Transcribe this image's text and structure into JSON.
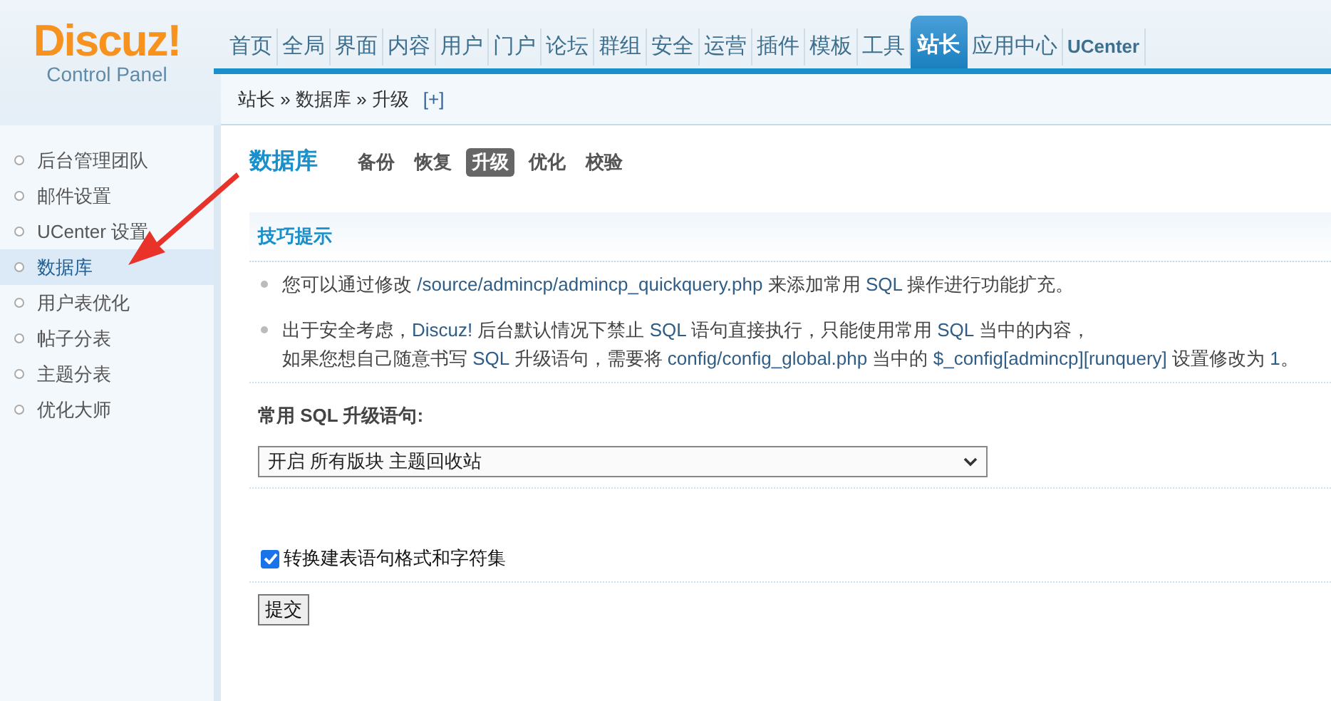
{
  "logo": {
    "name": "Discuz!",
    "subtitle": "Control Panel"
  },
  "nav": [
    {
      "label": "首页",
      "selected": false
    },
    {
      "label": "全局",
      "selected": false
    },
    {
      "label": "界面",
      "selected": false
    },
    {
      "label": "内容",
      "selected": false
    },
    {
      "label": "用户",
      "selected": false
    },
    {
      "label": "门户",
      "selected": false
    },
    {
      "label": "论坛",
      "selected": false
    },
    {
      "label": "群组",
      "selected": false
    },
    {
      "label": "安全",
      "selected": false
    },
    {
      "label": "运营",
      "selected": false
    },
    {
      "label": "插件",
      "selected": false
    },
    {
      "label": "模板",
      "selected": false
    },
    {
      "label": "工具",
      "selected": false
    },
    {
      "label": "站长",
      "selected": true
    },
    {
      "label": "应用中心",
      "selected": false
    },
    {
      "label": "UCenter",
      "selected": false
    }
  ],
  "breadcrumb": {
    "items": [
      "站长",
      "数据库",
      "升级"
    ],
    "separator": "»",
    "add": "[+]"
  },
  "sidebar": {
    "items": [
      {
        "label": "后台管理团队",
        "selected": false
      },
      {
        "label": "邮件设置",
        "selected": false
      },
      {
        "label": "UCenter 设置",
        "selected": false
      },
      {
        "label": "数据库",
        "selected": true
      },
      {
        "label": "用户表优化",
        "selected": false
      },
      {
        "label": "帖子分表",
        "selected": false
      },
      {
        "label": "主题分表",
        "selected": false
      },
      {
        "label": "优化大师",
        "selected": false
      }
    ]
  },
  "page": {
    "title": "数据库",
    "tabs": [
      {
        "label": "备份",
        "selected": false
      },
      {
        "label": "恢复",
        "selected": false
      },
      {
        "label": "升级",
        "selected": true
      },
      {
        "label": "优化",
        "selected": false
      },
      {
        "label": "校验",
        "selected": false
      }
    ]
  },
  "tips": {
    "title": "技巧提示",
    "items": [
      {
        "lines": [
          [
            {
              "text": "您可以通过修改 ",
              "kind": "text"
            },
            {
              "text": "/source/admincp/admincp_quickquery.php",
              "kind": "code"
            },
            {
              "text": " 来添加常用 ",
              "kind": "text"
            },
            {
              "text": "SQL",
              "kind": "code"
            },
            {
              "text": " 操作进行功能扩充。",
              "kind": "text"
            }
          ]
        ]
      },
      {
        "lines": [
          [
            {
              "text": "出于安全考虑，",
              "kind": "text"
            },
            {
              "text": "Discuz!",
              "kind": "code"
            },
            {
              "text": " 后台默认情况下禁止 ",
              "kind": "text"
            },
            {
              "text": "SQL",
              "kind": "code"
            },
            {
              "text": " 语句直接执行，只能使用常用 ",
              "kind": "text"
            },
            {
              "text": "SQL",
              "kind": "code"
            },
            {
              "text": " 当中的内容，",
              "kind": "text"
            }
          ],
          [
            {
              "text": "如果您想自己随意书写 ",
              "kind": "text"
            },
            {
              "text": "SQL",
              "kind": "code"
            },
            {
              "text": " 升级语句，需要将 ",
              "kind": "text"
            },
            {
              "text": "config/config_global.php",
              "kind": "code"
            },
            {
              "text": " 当中的 ",
              "kind": "text"
            },
            {
              "text": "$_config[admincp][runquery]",
              "kind": "code"
            },
            {
              "text": " 设置修改为 ",
              "kind": "text"
            },
            {
              "text": "1",
              "kind": "code"
            },
            {
              "text": "。",
              "kind": "text"
            }
          ]
        ]
      }
    ]
  },
  "form": {
    "label": "常用 SQL 升级语句:",
    "select_value": "开启 所有版块 主题回收站",
    "checkbox": {
      "label": "转换建表语句格式和字符集",
      "checked": true
    },
    "submit": "提交"
  }
}
